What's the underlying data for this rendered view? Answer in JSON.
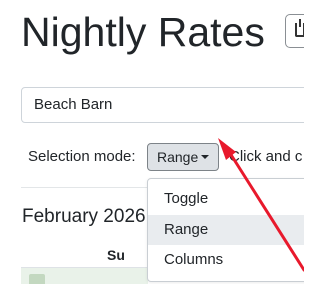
{
  "header": {
    "title": "Nightly Rates",
    "action_icon": "share-icon"
  },
  "listing": {
    "selected": "Beach Barn"
  },
  "selection_mode": {
    "label": "Selection mode:",
    "current": "Range",
    "hint": "Click and c"
  },
  "dropdown": {
    "items": [
      {
        "label": "Toggle",
        "active": false
      },
      {
        "label": "Range",
        "active": true
      },
      {
        "label": "Columns",
        "active": false
      }
    ]
  },
  "calendar": {
    "month": "February 2026",
    "weekdays": [
      "Su"
    ]
  },
  "colors": {
    "annotation_arrow": "#e8192c",
    "active_item_bg": "#e9ecef",
    "calendar_cell_bg": "#e9f2e9"
  }
}
